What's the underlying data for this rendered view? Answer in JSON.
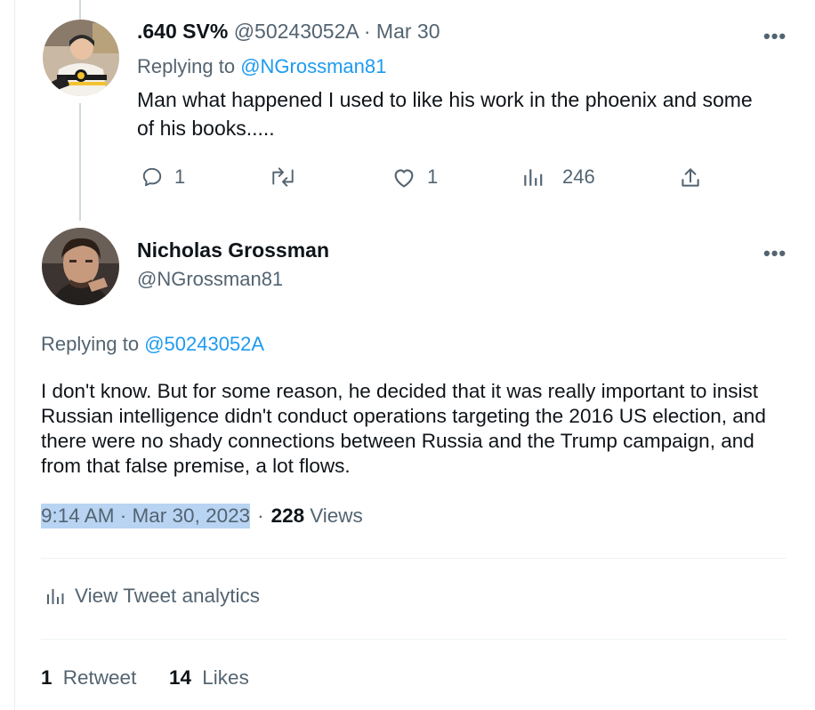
{
  "reply": {
    "author_name": ".640 SV%",
    "handle": "@50243052A",
    "separator": "·",
    "date": "Mar 30",
    "more": "•••",
    "replying_prefix": "Replying to",
    "replying_to": "@NGrossman81",
    "text": "Man what happened I used to like his work in the phoenix and some of  his books.....",
    "actions": {
      "reply_count": "1",
      "retweet_count": "",
      "like_count": "1",
      "views_count": "246"
    },
    "icons": {
      "avatar": "hockey-player-avatar",
      "reply": "comment-icon",
      "retweet": "retweet-icon",
      "like": "heart-icon",
      "views": "bar-chart-icon",
      "share": "share-icon"
    }
  },
  "tweet": {
    "author_name": "Nicholas Grossman",
    "handle": "@NGrossman81",
    "more": "•••",
    "replying_prefix": "Replying to",
    "replying_to": "@50243052A",
    "text": "I don't know. But for some reason, he decided that it was really important to insist Russian intelligence didn't conduct operations targeting the 2016 US election, and there were no shady connections between Russia and the Trump campaign, and from that false premise, a lot flows.",
    "timestamp": "9:14 AM · Mar 30, 2023",
    "separator": "·",
    "views_count": "228",
    "views_label": "Views",
    "analytics_label": "View Tweet analytics",
    "retweets_count": "1",
    "retweets_label": "Retweet",
    "likes_count": "14",
    "likes_label": "Likes"
  },
  "colors": {
    "link": "#1d9bf0",
    "muted": "#536471",
    "text": "#0f1419",
    "highlight": "#b9d4f3",
    "thread_line": "#cfd9de"
  }
}
